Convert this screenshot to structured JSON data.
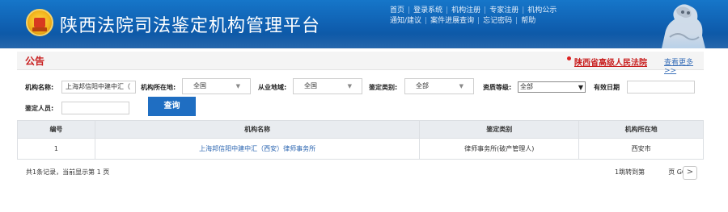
{
  "header": {
    "site_title": "陕西法院司法鉴定机构管理平台",
    "nav_row1": [
      "首页",
      "登录系统",
      "机构注册",
      "专家注册",
      "机构公示"
    ],
    "nav_row2": [
      "通知/建议",
      "案件进展查询",
      "忘记密码",
      "帮助"
    ],
    "emblem_icon": "court-emblem-icon",
    "lion_icon": "stone-lion-icon",
    "brand_color": "#1267bb"
  },
  "notice": {
    "title": "公告",
    "court_link": "陕西省高级人民法院",
    "more_link": "查看更多>>",
    "accent_color": "#c81e1e"
  },
  "search": {
    "name_label": "机构名称:",
    "name_value": "上海邦信阳中建中汇（",
    "location_label": "机构所在地:",
    "location_value": "全国",
    "practice_label": "从业地域:",
    "practice_value": "全国",
    "type_label": "鉴定类别:",
    "type_value": "全部",
    "level_label": "资质等级:",
    "level_value": "全部",
    "valid_date_label": "有效日期",
    "valid_date_value": "",
    "person_label": "鉴定人员:",
    "person_value": "",
    "query_button": "查询"
  },
  "table": {
    "headers": [
      "编号",
      "机构名称",
      "鉴定类别",
      "机构所在地"
    ],
    "rows": [
      [
        "1",
        "上海邦信阳中建中汇（西安）律师事务所",
        "律师事务所(破产管理人)",
        "西安市"
      ]
    ]
  },
  "footer": {
    "summary": "共1条记录，当前显示第 1 页",
    "jump_text": "1跳转到第",
    "page_go": "页 GO",
    "next_icon": "chevron-right-icon"
  }
}
